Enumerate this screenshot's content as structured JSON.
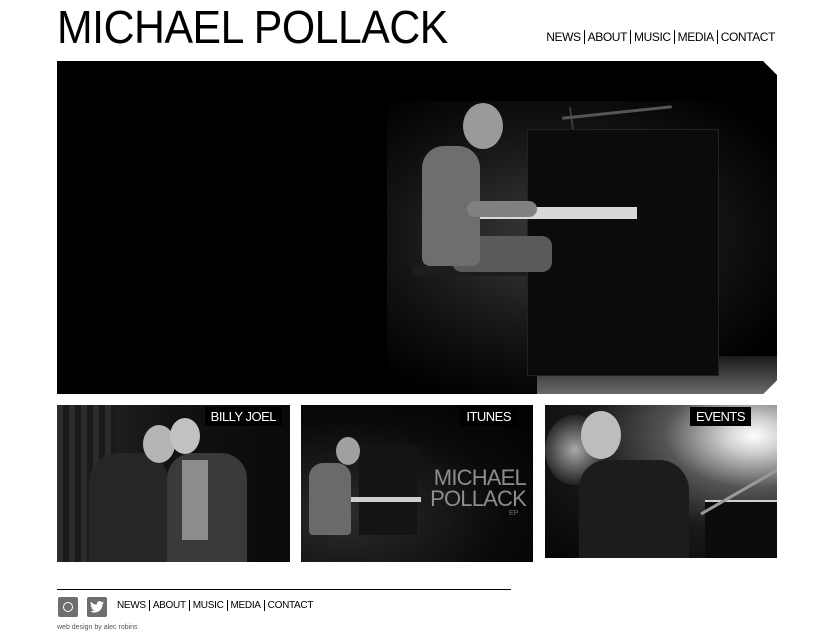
{
  "site": {
    "title": "MICHAEL POLLACK"
  },
  "nav": {
    "items": [
      "NEWS",
      "ABOUT",
      "MUSIC",
      "MEDIA",
      "CONTACT"
    ]
  },
  "tiles": [
    {
      "label": "BILLY JOEL"
    },
    {
      "label": "ITUNES",
      "album_title": "MICHAEL POLLACK",
      "album_subtitle": "EP"
    },
    {
      "label": "EVENTS"
    }
  ],
  "footer": {
    "social": [
      {
        "icon": "instagram-icon"
      },
      {
        "icon": "twitter-icon"
      }
    ],
    "nav": [
      "NEWS",
      "ABOUT",
      "MUSIC",
      "MEDIA",
      "CONTACT"
    ],
    "credit": "web design by alec robins"
  }
}
